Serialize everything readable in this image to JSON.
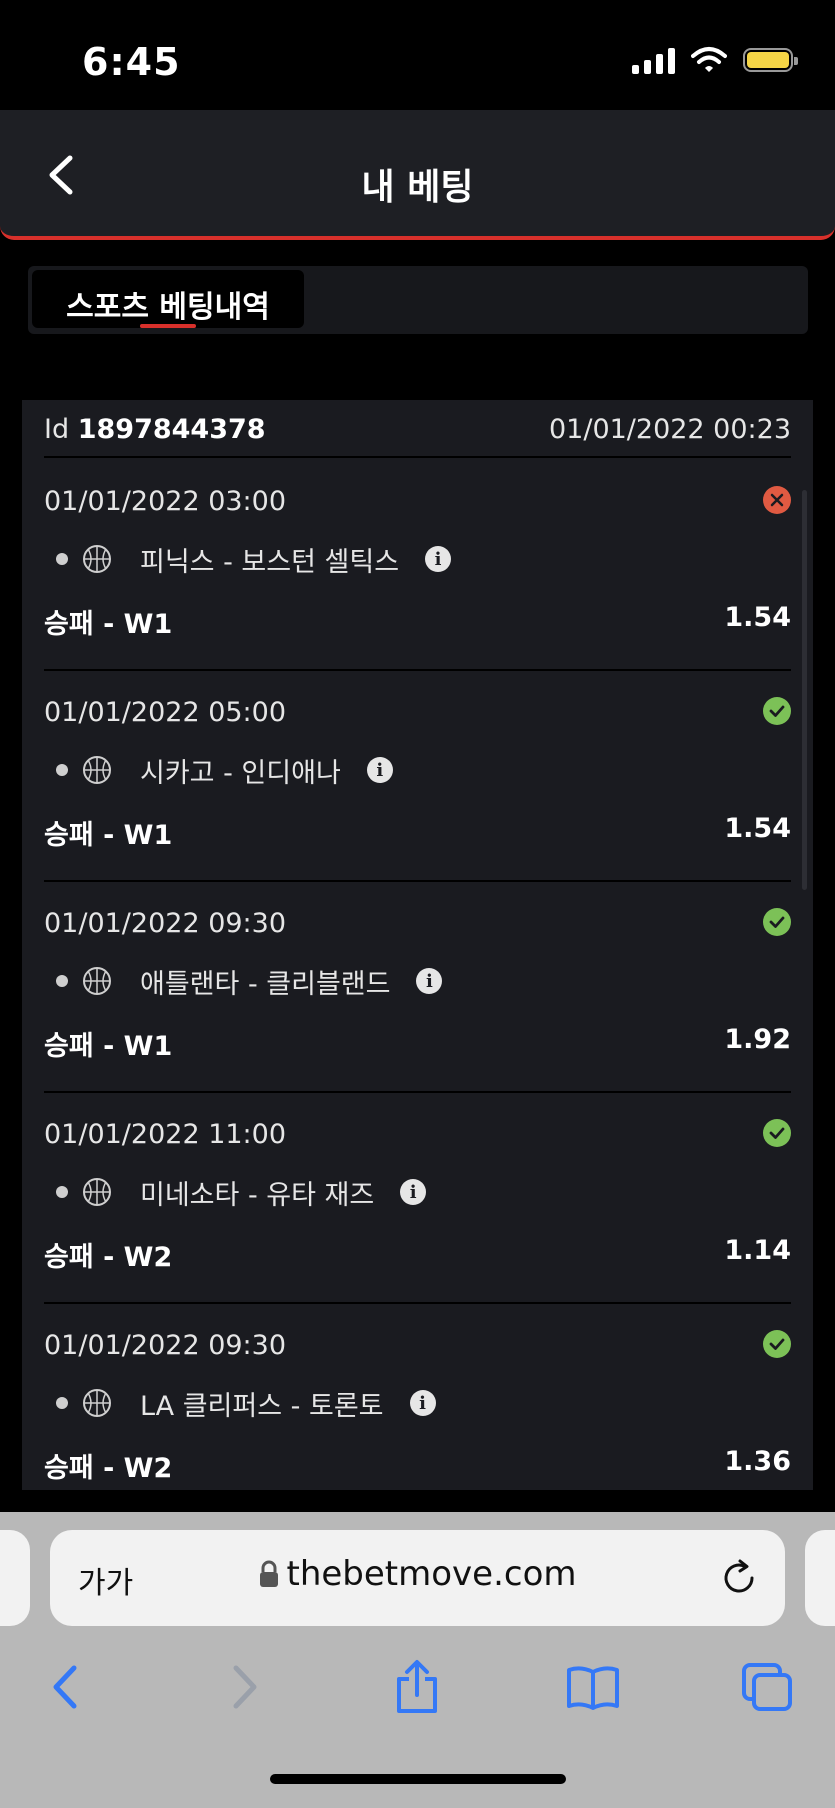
{
  "status_bar": {
    "time": "6:45"
  },
  "header": {
    "title": "내 베팅"
  },
  "tabs": [
    {
      "label": "스포츠 베팅내역",
      "active": true
    }
  ],
  "bet": {
    "id_label": "Id",
    "id": "1897844378",
    "placed_at": "01/01/2022 00:23",
    "selections": [
      {
        "time": "01/01/2022 03:00",
        "status": "lost",
        "sport_icon": "basketball-icon",
        "match": "피닉스 - 보스턴 셀틱스",
        "market": "승패 - W1",
        "odds": "1.54"
      },
      {
        "time": "01/01/2022 05:00",
        "status": "won",
        "sport_icon": "basketball-icon",
        "match": "시카고 - 인디애나",
        "market": "승패 - W1",
        "odds": "1.54"
      },
      {
        "time": "01/01/2022 09:30",
        "status": "won",
        "sport_icon": "basketball-icon",
        "match": "애틀랜타 - 클리블랜드",
        "market": "승패 - W1",
        "odds": "1.92"
      },
      {
        "time": "01/01/2022 11:00",
        "status": "won",
        "sport_icon": "basketball-icon",
        "match": "미네소타 - 유타 재즈",
        "market": "승패 - W2",
        "odds": "1.14"
      },
      {
        "time": "01/01/2022 09:30",
        "status": "won",
        "sport_icon": "basketball-icon",
        "match": "LA 클리퍼스 - 토론토",
        "market": "승패 - W2",
        "odds": "1.36"
      }
    ]
  },
  "browser": {
    "text_size_label": "가가",
    "url": "thebetmove.com"
  },
  "colors": {
    "accent": "#d8302b",
    "won": "#7cc157",
    "lost": "#e05a42",
    "browser_blue": "#3478f6"
  }
}
